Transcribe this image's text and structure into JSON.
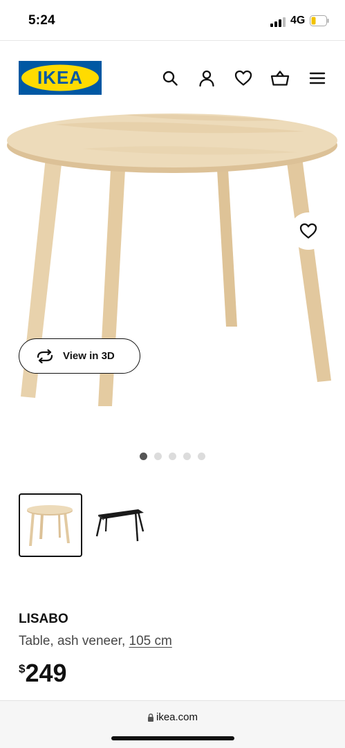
{
  "status": {
    "time": "5:24",
    "network": "4G"
  },
  "header": {
    "logo_text": "IKEA",
    "icons": [
      "search-icon",
      "user-icon",
      "heart-icon",
      "basket-icon",
      "menu-icon"
    ]
  },
  "gallery": {
    "view3d_label": "View in 3D",
    "dots_count": 5,
    "active_dot": 1,
    "thumbnails": [
      "ash-veneer-table",
      "black-table"
    ]
  },
  "product": {
    "name": "LISABO",
    "description": "Table, ash veneer, ",
    "size": "105 cm",
    "currency": "$",
    "price": "249"
  },
  "browser": {
    "url": "ikea.com"
  },
  "colors": {
    "brand_blue": "#0058A3",
    "brand_yellow": "#FFDB00",
    "wood": "#EAD5B0"
  }
}
